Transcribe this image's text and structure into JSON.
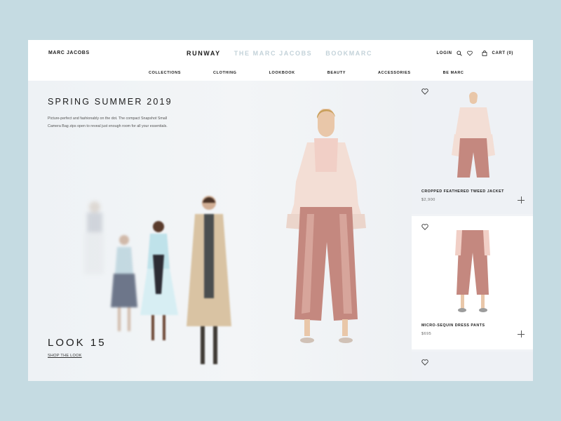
{
  "header": {
    "brand": "MARC JACOBS",
    "tabs": [
      {
        "label": "RUNWAY",
        "active": true
      },
      {
        "label": "THE MARC JACOBS",
        "active": false
      },
      {
        "label": "BOOKMARC",
        "active": false
      }
    ],
    "login": "LOGIN",
    "cart": "CART (0)",
    "nav": [
      "COLLECTIONS",
      "CLOTHING",
      "LOOKBOOK",
      "BEAUTY",
      "ACCESSORIES",
      "BE MARC"
    ]
  },
  "hero": {
    "title": "SPRING SUMMER 2019",
    "description": "Picture-perfect and fashionably on the dot. The compact Snapshot Small Camera Bag zips open to reveal just enough room for all your essentials.",
    "look": "LOOK 15",
    "shop_link": "SHOP THE LOOK"
  },
  "products": [
    {
      "name": "CROPPED FEATHERED TWEED JACKET",
      "price": "$2,900"
    },
    {
      "name": "MICRO-SEQUIN DRESS PANTS",
      "price": "$695"
    }
  ],
  "icons": [
    "search-icon",
    "heart-icon",
    "bag-icon",
    "plus-icon"
  ],
  "colors": {
    "background": "#c5dbe2",
    "muted_tab": "#c3d2d9",
    "sequin": "#c4887f",
    "jacket": "#f2ddd4"
  }
}
